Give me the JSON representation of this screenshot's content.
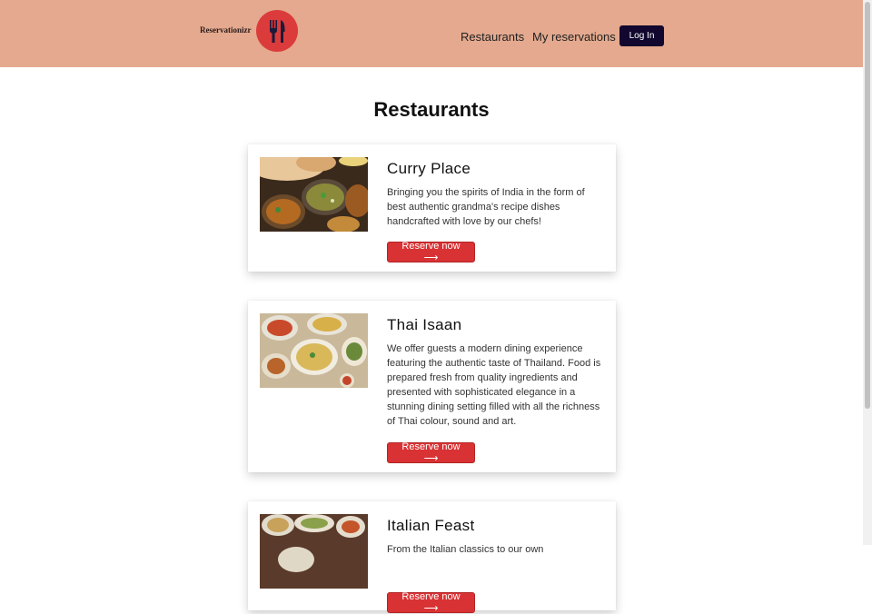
{
  "header": {
    "brand": "Reservationizr",
    "logo_icon": "fork-knife-icon",
    "nav": [
      {
        "label": "Restaurants"
      },
      {
        "label": "My reservations"
      }
    ],
    "login_label": "Log In",
    "colors": {
      "header_bg": "#e4a98e",
      "logo_bg": "#dc3b3b",
      "login_bg": "#12082f"
    }
  },
  "main": {
    "title": "Restaurants",
    "restaurants": [
      {
        "name": "Curry Place",
        "description": "Bringing you the spirits of India in the form of best authentic grandma's recipe dishes handcrafted with love by our chefs!",
        "button_label": "Reserve now ⟶"
      },
      {
        "name": "Thai Isaan",
        "description": "We offer guests a modern dining experience featuring the authentic taste of Thailand. Food is prepared fresh from quality ingredients and presented with sophisticated elegance in a stunning dining setting filled with all the richness of Thai colour, sound and art.",
        "button_label": "Reserve now ⟶"
      },
      {
        "name": "Italian Feast",
        "description": "From the Italian classics to our own",
        "button_label": "Reserve now ⟶"
      }
    ],
    "colors": {
      "button_bg": "#d93234"
    }
  }
}
